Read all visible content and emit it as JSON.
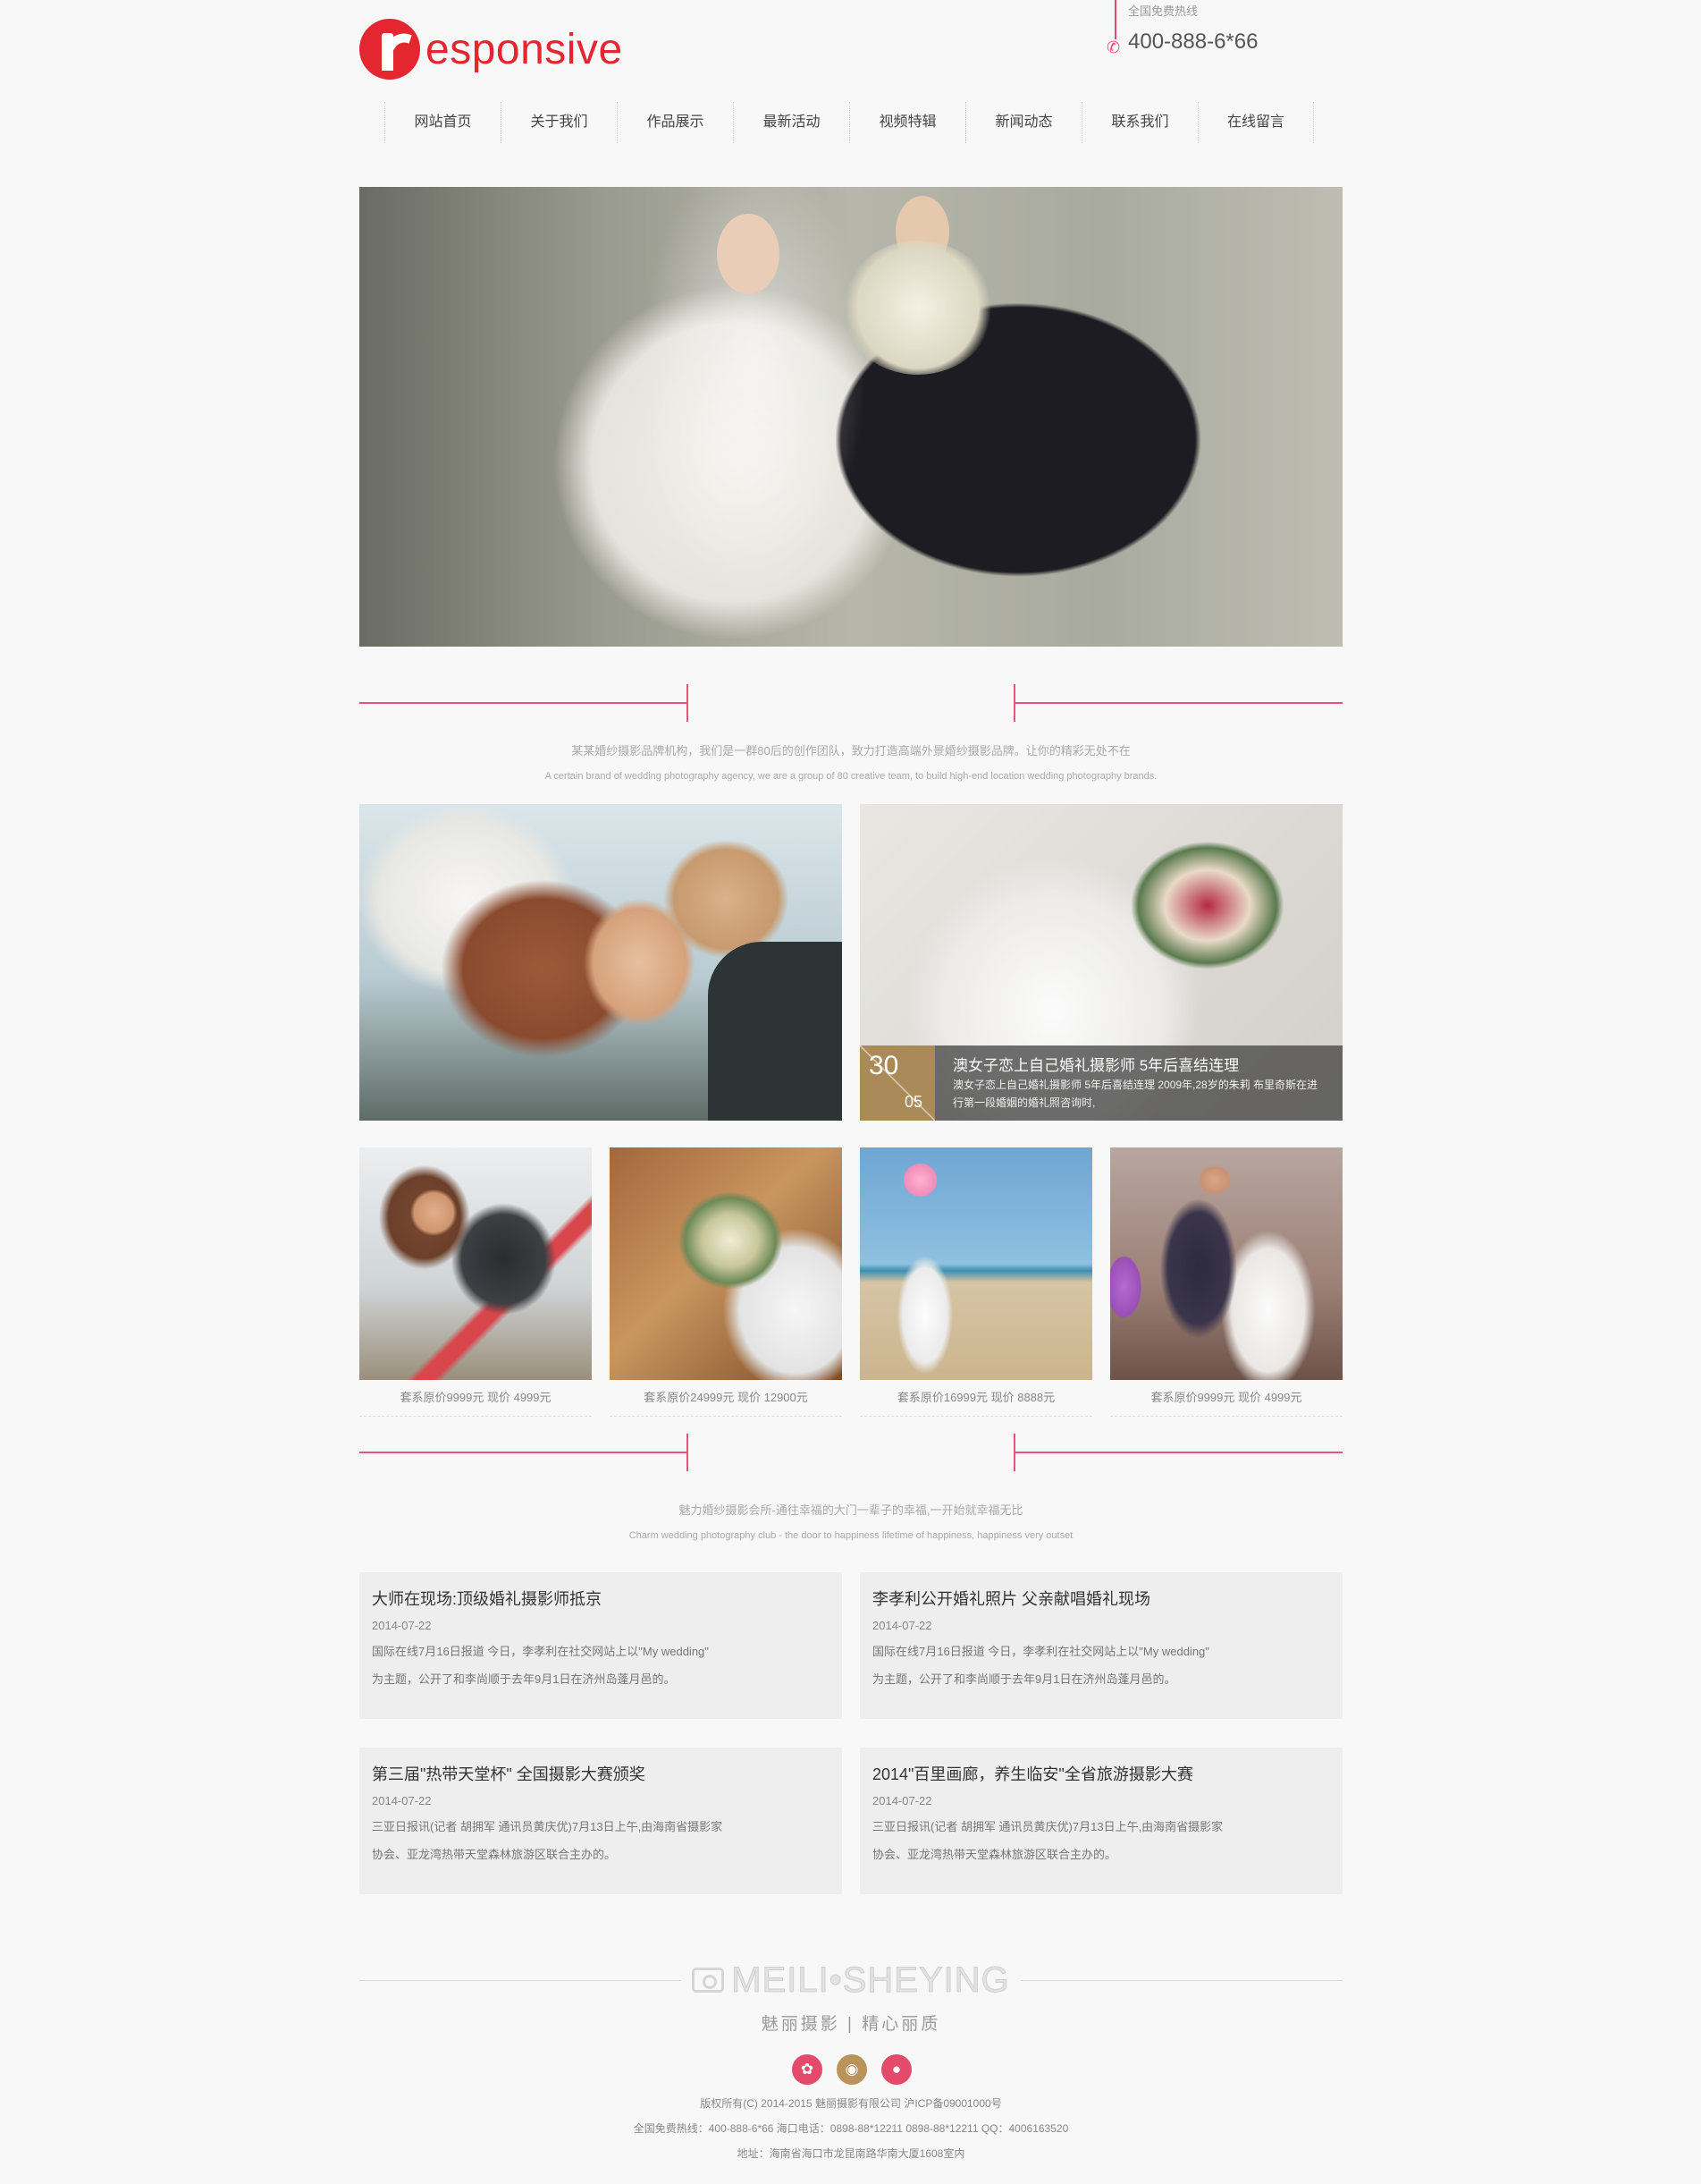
{
  "header": {
    "logo_text": "esponsive",
    "hotline_label": "全国免费热线",
    "hotline_number": "400-888-6*66"
  },
  "nav": [
    "网站首页",
    "关于我们",
    "作品展示",
    "最新活动",
    "视频特辑",
    "新闻动态",
    "联系我们",
    "在线留言"
  ],
  "intro": {
    "cn": "某某婚纱摄影品牌机构，我们是一群80后的创作团队，致力打造高端外景婚纱摄影品牌。让你的精彩无处不在",
    "en": "A certain brand of wedding photography agency, we are a group of 80 creative team, to build high-end location wedding photography brands."
  },
  "featured": {
    "day": "30",
    "month": "05",
    "title": "澳女子恋上自己婚礼摄影师 5年后喜结连理",
    "text": "澳女子恋上自己婚礼摄影师 5年后喜结连理 2009年,28岁的朱莉 布里奇斯在进行第一段婚姻的婚礼照咨询时,"
  },
  "gallery": [
    "套系原价9999元 现价 4999元",
    "套系原价24999元 现价 12900元",
    "套系原价16999元 现价 8888元",
    "套系原价9999元 现价 4999元"
  ],
  "club": {
    "cn": "魅力婚纱摄影会所-通往幸福的大门一辈子的幸福,一开始就幸福无比",
    "en": "Charm wedding photography club - the door to happiness lifetime of happiness, happiness very outset"
  },
  "news": [
    {
      "title": "大师在现场:顶级婚礼摄影师抵京",
      "date": "2014-07-22",
      "line1": "国际在线7月16日报道 今日，李孝利在社交网站上以\"My wedding\"",
      "line2": "为主题，公开了和李尚顺于去年9月1日在济州岛蓬月邑的。"
    },
    {
      "title": "李孝利公开婚礼照片 父亲献唱婚礼现场",
      "date": "2014-07-22",
      "line1": "国际在线7月16日报道 今日，李孝利在社交网站上以\"My wedding\"",
      "line2": "为主题，公开了和李尚顺于去年9月1日在济州岛蓬月邑的。"
    },
    {
      "title": "第三届\"热带天堂杯\" 全国摄影大赛颁奖",
      "date": "2014-07-22",
      "line1": "三亚日报讯(记者 胡拥军 通讯员黄庆优)7月13日上午,由海南省摄影家",
      "line2": "协会、亚龙湾热带天堂森林旅游区联合主办的。"
    },
    {
      "title": "2014\"百里画廊，养生临安\"全省旅游摄影大赛",
      "date": "2014-07-22",
      "line1": "三亚日报讯(记者 胡拥军 通讯员黄庆优)7月13日上午,由海南省摄影家",
      "line2": "协会、亚龙湾热带天堂森林旅游区联合主办的。"
    }
  ],
  "footer": {
    "brand": "MEILI•SHEYING",
    "slogan": "魅丽摄影 | 精心丽质",
    "social_icons": [
      "weibo-icon",
      "tencent-weibo-icon",
      "wechat-icon"
    ],
    "copyright": "版权所有(C) 2014-2015 魅丽摄影有限公司 沪ICP备09001000号",
    "contact": "全国免费热线：400-888-6*66 海口电话：0898-88*12211 0898-88*12211 QQ：4006163520",
    "address": "地址：海南省海口市龙昆南路华南大厦1608室内"
  },
  "colors": {
    "accent": "#e3262f",
    "divider": "#e3537a",
    "gold": "#b08d57"
  }
}
